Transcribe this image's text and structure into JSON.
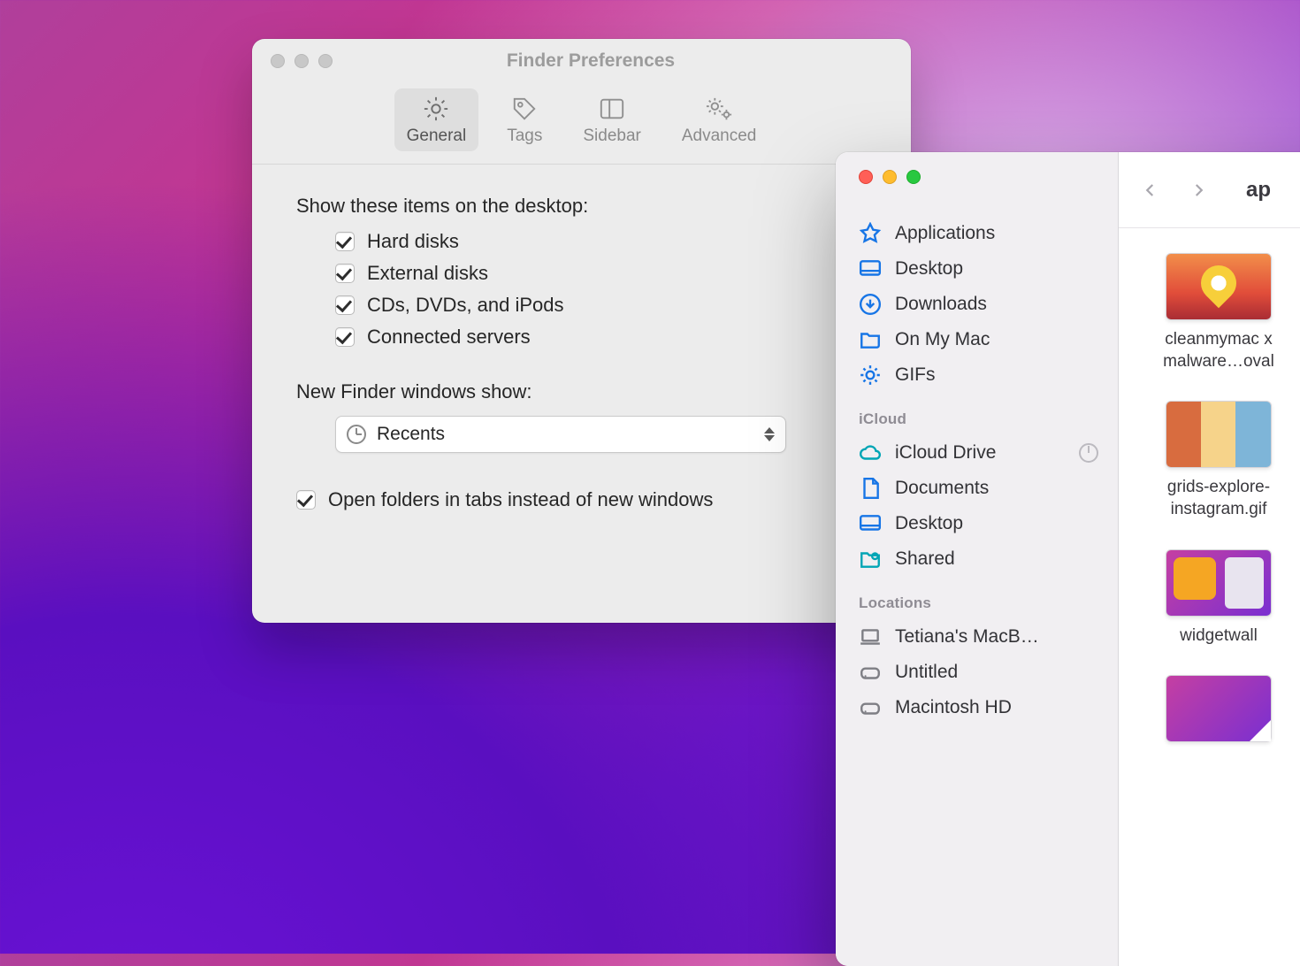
{
  "prefs": {
    "title": "Finder Preferences",
    "tabs": [
      {
        "id": "general",
        "label": "General",
        "selected": true
      },
      {
        "id": "tags",
        "label": "Tags",
        "selected": false
      },
      {
        "id": "sidebar",
        "label": "Sidebar",
        "selected": false
      },
      {
        "id": "advanced",
        "label": "Advanced",
        "selected": false
      }
    ],
    "desktop_items_label": "Show these items on the desktop:",
    "desktop_items": [
      {
        "label": "Hard disks",
        "checked": true
      },
      {
        "label": "External disks",
        "checked": true
      },
      {
        "label": "CDs, DVDs, and iPods",
        "checked": true
      },
      {
        "label": "Connected servers",
        "checked": true
      }
    ],
    "new_windows_label": "New Finder windows show:",
    "new_windows_value": "Recents",
    "tabs_checkbox": {
      "label": "Open folders in tabs instead of new windows",
      "checked": true
    }
  },
  "finder": {
    "path_title": "ap",
    "sidebar": {
      "favorites": [
        {
          "id": "applications",
          "label": "Applications",
          "icon": "app"
        },
        {
          "id": "desktop",
          "label": "Desktop",
          "icon": "desktop"
        },
        {
          "id": "downloads",
          "label": "Downloads",
          "icon": "download"
        },
        {
          "id": "onmymac",
          "label": "On My Mac",
          "icon": "folder"
        },
        {
          "id": "gifs",
          "label": "GIFs",
          "icon": "gear"
        }
      ],
      "icloud_label": "iCloud",
      "icloud": [
        {
          "id": "iclouddrive",
          "label": "iCloud Drive",
          "icon": "cloud",
          "loading": true
        },
        {
          "id": "documents",
          "label": "Documents",
          "icon": "doc"
        },
        {
          "id": "desktop2",
          "label": "Desktop",
          "icon": "desktop"
        },
        {
          "id": "shared",
          "label": "Shared",
          "icon": "shared"
        }
      ],
      "locations_label": "Locations",
      "locations": [
        {
          "id": "macbook",
          "label": "Tetiana's MacB…",
          "icon": "laptop"
        },
        {
          "id": "untitled",
          "label": "Untitled",
          "icon": "disk"
        },
        {
          "id": "machd",
          "label": "Macintosh HD",
          "icon": "disk"
        }
      ]
    },
    "files": [
      {
        "name": "cleanmymac x malware…oval",
        "thumb": "t1"
      },
      {
        "name": "grids-explore-instagram.gif",
        "thumb": "t2"
      },
      {
        "name": "widgetwall",
        "thumb": "t3"
      },
      {
        "name": "",
        "thumb": "t4"
      }
    ]
  }
}
